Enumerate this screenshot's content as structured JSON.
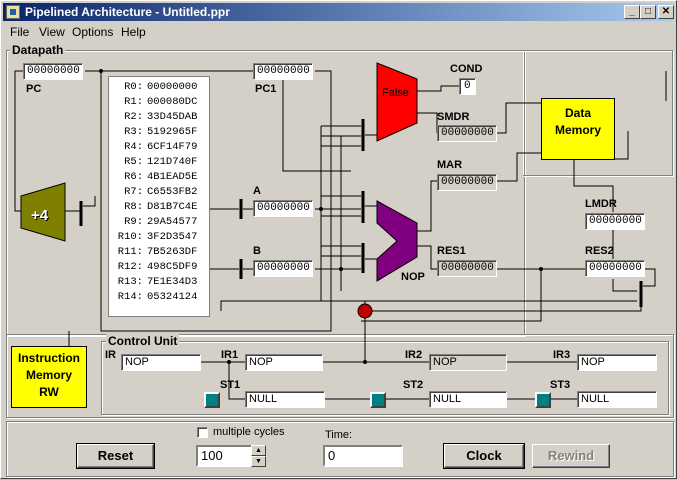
{
  "window": {
    "title": "Pipelined Architecture - Untitled.ppr",
    "controls": {
      "minimize": "_",
      "maximize": "□",
      "close": "✕"
    }
  },
  "menu": [
    "File",
    "View",
    "Options",
    "Help"
  ],
  "datapath": {
    "label": "Datapath",
    "pc": {
      "label": "PC",
      "value": "00000000"
    },
    "pc1": {
      "label": "PC1",
      "value": "00000000"
    },
    "adder_label": "+4",
    "registers": [
      {
        "name": "R0:",
        "value": "00000000"
      },
      {
        "name": "R1:",
        "value": "000080DC"
      },
      {
        "name": "R2:",
        "value": "33D45DAB"
      },
      {
        "name": "R3:",
        "value": "5192965F"
      },
      {
        "name": "R4:",
        "value": "6CF14F79"
      },
      {
        "name": "R5:",
        "value": "121D740F"
      },
      {
        "name": "R6:",
        "value": "4B1EAD5E"
      },
      {
        "name": "R7:",
        "value": "C6553FB2"
      },
      {
        "name": "R8:",
        "value": "D81B7C4E"
      },
      {
        "name": "R9:",
        "value": "29A54577"
      },
      {
        "name": "R10:",
        "value": "3F2D3547"
      },
      {
        "name": "R11:",
        "value": "7B5263DF"
      },
      {
        "name": "R12:",
        "value": "498C5DF9"
      },
      {
        "name": "R13:",
        "value": "7E1E34D3"
      },
      {
        "name": "R14:",
        "value": "05324124"
      }
    ],
    "a": {
      "label": "A",
      "value": "00000000"
    },
    "b": {
      "label": "B",
      "value": "00000000"
    },
    "comparator": {
      "value": "False",
      "color": "#ff0000"
    },
    "cond": {
      "label": "COND",
      "value": "0"
    },
    "smdr": {
      "label": "SMDR",
      "value": "00000000"
    },
    "mar": {
      "label": "MAR",
      "value": "00000000"
    },
    "alu": {
      "op": "NOP",
      "color": "#800080"
    },
    "res1": {
      "label": "RES1",
      "value": "00000000"
    },
    "res2": {
      "label": "RES2",
      "value": "00000000"
    },
    "lmdr": {
      "label": "LMDR",
      "value": "00000000"
    },
    "data_memory": {
      "line1": "Data",
      "line2": "Memory"
    },
    "box_color": "#ffff00",
    "adder_color": "#808000"
  },
  "instruction_memory": {
    "line1": "Instruction",
    "line2": "Memory",
    "mode": "RW"
  },
  "control_unit": {
    "label": "Control Unit",
    "ir": {
      "label": "IR",
      "value": "NOP"
    },
    "ir1": {
      "label": "IR1",
      "value": "NOP"
    },
    "ir2": {
      "label": "IR2",
      "value": "NOP"
    },
    "ir3": {
      "label": "IR3",
      "value": "NOP"
    },
    "st1": {
      "label": "ST1",
      "value": "NULL"
    },
    "st2": {
      "label": "ST2",
      "value": "NULL"
    },
    "st3": {
      "label": "ST3",
      "value": "NULL"
    }
  },
  "bottom": {
    "reset_label": "Reset",
    "multiple_cycles_label": "multiple cycles",
    "multiple_cycles_checked": false,
    "cycles_value": "100",
    "time_label": "Time:",
    "time_value": "0",
    "clock_label": "Clock",
    "rewind_label": "Rewind"
  }
}
